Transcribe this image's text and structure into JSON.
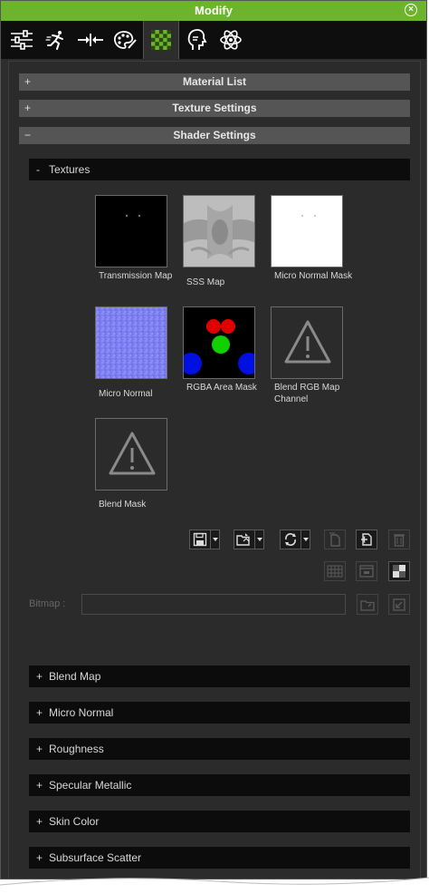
{
  "window": {
    "title": "Modify"
  },
  "tabs": [
    {
      "name": "sliders-icon"
    },
    {
      "name": "motion-figure-icon"
    },
    {
      "name": "merge-arrows-icon"
    },
    {
      "name": "palette-icon"
    },
    {
      "name": "checker-material-icon",
      "active": true
    },
    {
      "name": "head-profile-icon"
    },
    {
      "name": "atom-physics-icon"
    }
  ],
  "sections": {
    "material_list": {
      "sign": "+",
      "label": "Material List"
    },
    "texture_settings": {
      "sign": "+",
      "label": "Texture Settings"
    },
    "shader_settings": {
      "sign": "−",
      "label": "Shader Settings"
    }
  },
  "textures": {
    "header": {
      "sign": "-",
      "label": "Textures"
    },
    "slots": [
      {
        "label": "Transmission Map"
      },
      {
        "label": "SSS Map"
      },
      {
        "label": "Micro Normal Mask"
      },
      {
        "label": "Micro Normal"
      },
      {
        "label": "RGBA Area Mask"
      },
      {
        "label": "Blend RGB Map Channel"
      },
      {
        "label": "Blend Mask"
      }
    ]
  },
  "bitmap": {
    "label": "Bitmap :",
    "value": ""
  },
  "subsections": [
    {
      "sign": "+",
      "label": "Blend Map"
    },
    {
      "sign": "+",
      "label": "Micro Normal"
    },
    {
      "sign": "+",
      "label": "Roughness"
    },
    {
      "sign": "+",
      "label": "Specular Metallic"
    },
    {
      "sign": "+",
      "label": "Skin Color"
    },
    {
      "sign": "+",
      "label": "Subsurface Scatter"
    }
  ],
  "colors": {
    "accent": "#6cb42c",
    "panel": "#2d2d2d",
    "header": "#555555",
    "subheader": "#0c0c0c"
  }
}
